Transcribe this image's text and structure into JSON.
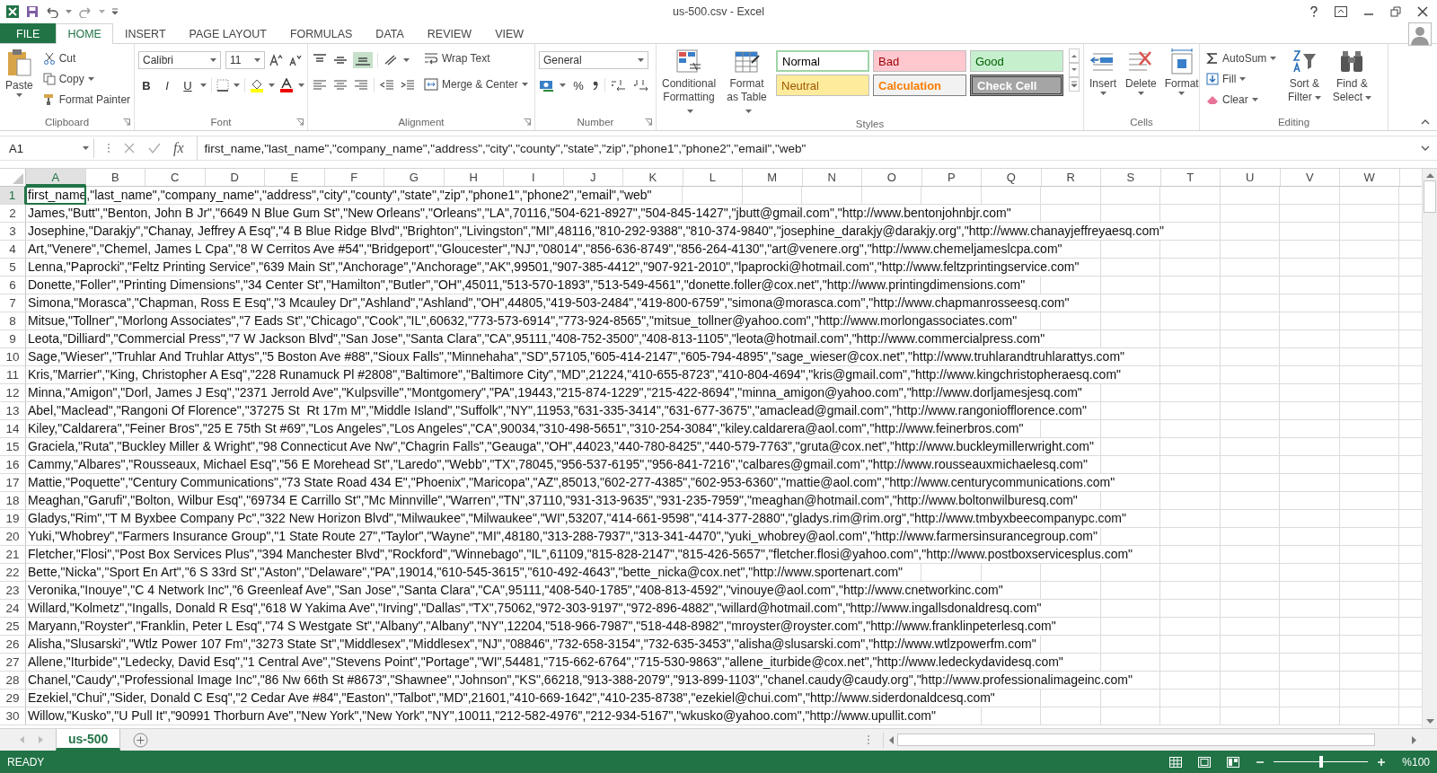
{
  "title_bar": {
    "title": "us-500.csv - Excel"
  },
  "tabs": [
    {
      "label": "FILE",
      "kind": "file",
      "selected": false
    },
    {
      "label": "HOME",
      "kind": "tab",
      "selected": true
    },
    {
      "label": "INSERT",
      "kind": "tab",
      "selected": false
    },
    {
      "label": "PAGE LAYOUT",
      "kind": "tab",
      "selected": false
    },
    {
      "label": "FORMULAS",
      "kind": "tab",
      "selected": false
    },
    {
      "label": "DATA",
      "kind": "tab",
      "selected": false
    },
    {
      "label": "REVIEW",
      "kind": "tab",
      "selected": false
    },
    {
      "label": "VIEW",
      "kind": "tab",
      "selected": false
    }
  ],
  "ribbon": {
    "clipboard": {
      "label": "Clipboard",
      "paste": "Paste",
      "cut": "Cut",
      "copy": "Copy",
      "format_painter": "Format Painter"
    },
    "font": {
      "label": "Font",
      "name": "Calibri",
      "size": "11",
      "bold": "B",
      "italic": "I",
      "underline": "U"
    },
    "alignment": {
      "label": "Alignment",
      "wrap_text": "Wrap Text",
      "merge_center": "Merge & Center"
    },
    "number": {
      "label": "Number",
      "format": "General",
      "percent": "%"
    },
    "styles": {
      "label": "Styles",
      "conditional_formatting": "Conditional Formatting",
      "format_as_table": "Format as Table",
      "cell_styles": [
        {
          "label": "Normal",
          "kind": "normal",
          "selected": true
        },
        {
          "label": "Bad",
          "kind": "bad",
          "selected": false
        },
        {
          "label": "Good",
          "kind": "good",
          "selected": false
        },
        {
          "label": "Neutral",
          "kind": "neutral",
          "selected": false
        },
        {
          "label": "Calculation",
          "kind": "calculation",
          "selected": false
        },
        {
          "label": "Check Cell",
          "kind": "check",
          "selected": false
        }
      ]
    },
    "cells": {
      "label": "Cells",
      "buttons": [
        "Insert",
        "Delete",
        "Format"
      ]
    },
    "editing": {
      "label": "Editing",
      "autosum": "AutoSum",
      "fill": "Fill",
      "clear": "Clear",
      "sort_filter": "Sort & Filter",
      "find_select": "Find & Select"
    }
  },
  "formula_bar": {
    "name_box": "A1",
    "fx": "fx",
    "formula": "first_name,\"last_name\",\"company_name\",\"address\",\"city\",\"county\",\"state\",\"zip\",\"phone1\",\"phone2\",\"email\",\"web\""
  },
  "columns": [
    {
      "label": "A",
      "selected": true
    },
    {
      "label": "B",
      "selected": false
    },
    {
      "label": "C",
      "selected": false
    },
    {
      "label": "D",
      "selected": false
    },
    {
      "label": "E",
      "selected": false
    },
    {
      "label": "F",
      "selected": false
    },
    {
      "label": "G",
      "selected": false
    },
    {
      "label": "H",
      "selected": false
    },
    {
      "label": "I",
      "selected": false
    },
    {
      "label": "J",
      "selected": false
    },
    {
      "label": "K",
      "selected": false
    },
    {
      "label": "L",
      "selected": false
    },
    {
      "label": "M",
      "selected": false
    },
    {
      "label": "N",
      "selected": false
    },
    {
      "label": "O",
      "selected": false
    },
    {
      "label": "P",
      "selected": false
    },
    {
      "label": "Q",
      "selected": false
    },
    {
      "label": "R",
      "selected": false
    },
    {
      "label": "S",
      "selected": false
    },
    {
      "label": "T",
      "selected": false
    },
    {
      "label": "U",
      "selected": false
    },
    {
      "label": "V",
      "selected": false
    },
    {
      "label": "W",
      "selected": false
    }
  ],
  "rows": [
    {
      "number": "1",
      "selected": true,
      "text": "first_name,\"last_name\",\"company_name\",\"address\",\"city\",\"county\",\"state\",\"zip\",\"phone1\",\"phone2\",\"email\",\"web\""
    },
    {
      "number": "2",
      "selected": false,
      "text": "James,\"Butt\",\"Benton, John B Jr\",\"6649 N Blue Gum St\",\"New Orleans\",\"Orleans\",\"LA\",70116,\"504-621-8927\",\"504-845-1427\",\"jbutt@gmail.com\",\"http://www.bentonjohnbjr.com\""
    },
    {
      "number": "3",
      "selected": false,
      "text": "Josephine,\"Darakjy\",\"Chanay, Jeffrey A Esq\",\"4 B Blue Ridge Blvd\",\"Brighton\",\"Livingston\",\"MI\",48116,\"810-292-9388\",\"810-374-9840\",\"josephine_darakjy@darakjy.org\",\"http://www.chanayjeffreyaesq.com\""
    },
    {
      "number": "4",
      "selected": false,
      "text": "Art,\"Venere\",\"Chemel, James L Cpa\",\"8 W Cerritos Ave #54\",\"Bridgeport\",\"Gloucester\",\"NJ\",\"08014\",\"856-636-8749\",\"856-264-4130\",\"art@venere.org\",\"http://www.chemeljameslcpa.com\""
    },
    {
      "number": "5",
      "selected": false,
      "text": "Lenna,\"Paprocki\",\"Feltz Printing Service\",\"639 Main St\",\"Anchorage\",\"Anchorage\",\"AK\",99501,\"907-385-4412\",\"907-921-2010\",\"lpaprocki@hotmail.com\",\"http://www.feltzprintingservice.com\""
    },
    {
      "number": "6",
      "selected": false,
      "text": "Donette,\"Foller\",\"Printing Dimensions\",\"34 Center St\",\"Hamilton\",\"Butler\",\"OH\",45011,\"513-570-1893\",\"513-549-4561\",\"donette.foller@cox.net\",\"http://www.printingdimensions.com\""
    },
    {
      "number": "7",
      "selected": false,
      "text": "Simona,\"Morasca\",\"Chapman, Ross E Esq\",\"3 Mcauley Dr\",\"Ashland\",\"Ashland\",\"OH\",44805,\"419-503-2484\",\"419-800-6759\",\"simona@morasca.com\",\"http://www.chapmanrosseesq.com\""
    },
    {
      "number": "8",
      "selected": false,
      "text": "Mitsue,\"Tollner\",\"Morlong Associates\",\"7 Eads St\",\"Chicago\",\"Cook\",\"IL\",60632,\"773-573-6914\",\"773-924-8565\",\"mitsue_tollner@yahoo.com\",\"http://www.morlongassociates.com\""
    },
    {
      "number": "9",
      "selected": false,
      "text": "Leota,\"Dilliard\",\"Commercial Press\",\"7 W Jackson Blvd\",\"San Jose\",\"Santa Clara\",\"CA\",95111,\"408-752-3500\",\"408-813-1105\",\"leota@hotmail.com\",\"http://www.commercialpress.com\""
    },
    {
      "number": "10",
      "selected": false,
      "text": "Sage,\"Wieser\",\"Truhlar And Truhlar Attys\",\"5 Boston Ave #88\",\"Sioux Falls\",\"Minnehaha\",\"SD\",57105,\"605-414-2147\",\"605-794-4895\",\"sage_wieser@cox.net\",\"http://www.truhlarandtruhlarattys.com\""
    },
    {
      "number": "11",
      "selected": false,
      "text": "Kris,\"Marrier\",\"King, Christopher A Esq\",\"228 Runamuck Pl #2808\",\"Baltimore\",\"Baltimore City\",\"MD\",21224,\"410-655-8723\",\"410-804-4694\",\"kris@gmail.com\",\"http://www.kingchristopheraesq.com\""
    },
    {
      "number": "12",
      "selected": false,
      "text": "Minna,\"Amigon\",\"Dorl, James J Esq\",\"2371 Jerrold Ave\",\"Kulpsville\",\"Montgomery\",\"PA\",19443,\"215-874-1229\",\"215-422-8694\",\"minna_amigon@yahoo.com\",\"http://www.dorljamesjesq.com\""
    },
    {
      "number": "13",
      "selected": false,
      "text": "Abel,\"Maclead\",\"Rangoni Of Florence\",\"37275 St  Rt 17m M\",\"Middle Island\",\"Suffolk\",\"NY\",11953,\"631-335-3414\",\"631-677-3675\",\"amaclead@gmail.com\",\"http://www.rangoniofflorence.com\""
    },
    {
      "number": "14",
      "selected": false,
      "text": "Kiley,\"Caldarera\",\"Feiner Bros\",\"25 E 75th St #69\",\"Los Angeles\",\"Los Angeles\",\"CA\",90034,\"310-498-5651\",\"310-254-3084\",\"kiley.caldarera@aol.com\",\"http://www.feinerbros.com\""
    },
    {
      "number": "15",
      "selected": false,
      "text": "Graciela,\"Ruta\",\"Buckley Miller & Wright\",\"98 Connecticut Ave Nw\",\"Chagrin Falls\",\"Geauga\",\"OH\",44023,\"440-780-8425\",\"440-579-7763\",\"gruta@cox.net\",\"http://www.buckleymillerwright.com\""
    },
    {
      "number": "16",
      "selected": false,
      "text": "Cammy,\"Albares\",\"Rousseaux, Michael Esq\",\"56 E Morehead St\",\"Laredo\",\"Webb\",\"TX\",78045,\"956-537-6195\",\"956-841-7216\",\"calbares@gmail.com\",\"http://www.rousseauxmichaelesq.com\""
    },
    {
      "number": "17",
      "selected": false,
      "text": "Mattie,\"Poquette\",\"Century Communications\",\"73 State Road 434 E\",\"Phoenix\",\"Maricopa\",\"AZ\",85013,\"602-277-4385\",\"602-953-6360\",\"mattie@aol.com\",\"http://www.centurycommunications.com\""
    },
    {
      "number": "18",
      "selected": false,
      "text": "Meaghan,\"Garufi\",\"Bolton, Wilbur Esq\",\"69734 E Carrillo St\",\"Mc Minnville\",\"Warren\",\"TN\",37110,\"931-313-9635\",\"931-235-7959\",\"meaghan@hotmail.com\",\"http://www.boltonwilburesq.com\""
    },
    {
      "number": "19",
      "selected": false,
      "text": "Gladys,\"Rim\",\"T M Byxbee Company Pc\",\"322 New Horizon Blvd\",\"Milwaukee\",\"Milwaukee\",\"WI\",53207,\"414-661-9598\",\"414-377-2880\",\"gladys.rim@rim.org\",\"http://www.tmbyxbeecompanypc.com\""
    },
    {
      "number": "20",
      "selected": false,
      "text": "Yuki,\"Whobrey\",\"Farmers Insurance Group\",\"1 State Route 27\",\"Taylor\",\"Wayne\",\"MI\",48180,\"313-288-7937\",\"313-341-4470\",\"yuki_whobrey@aol.com\",\"http://www.farmersinsurancegroup.com\""
    },
    {
      "number": "21",
      "selected": false,
      "text": "Fletcher,\"Flosi\",\"Post Box Services Plus\",\"394 Manchester Blvd\",\"Rockford\",\"Winnebago\",\"IL\",61109,\"815-828-2147\",\"815-426-5657\",\"fletcher.flosi@yahoo.com\",\"http://www.postboxservicesplus.com\""
    },
    {
      "number": "22",
      "selected": false,
      "text": "Bette,\"Nicka\",\"Sport En Art\",\"6 S 33rd St\",\"Aston\",\"Delaware\",\"PA\",19014,\"610-545-3615\",\"610-492-4643\",\"bette_nicka@cox.net\",\"http://www.sportenart.com\""
    },
    {
      "number": "23",
      "selected": false,
      "text": "Veronika,\"Inouye\",\"C 4 Network Inc\",\"6 Greenleaf Ave\",\"San Jose\",\"Santa Clara\",\"CA\",95111,\"408-540-1785\",\"408-813-4592\",\"vinouye@aol.com\",\"http://www.cnetworkinc.com\""
    },
    {
      "number": "24",
      "selected": false,
      "text": "Willard,\"Kolmetz\",\"Ingalls, Donald R Esq\",\"618 W Yakima Ave\",\"Irving\",\"Dallas\",\"TX\",75062,\"972-303-9197\",\"972-896-4882\",\"willard@hotmail.com\",\"http://www.ingallsdonaldresq.com\""
    },
    {
      "number": "25",
      "selected": false,
      "text": "Maryann,\"Royster\",\"Franklin, Peter L Esq\",\"74 S Westgate St\",\"Albany\",\"Albany\",\"NY\",12204,\"518-966-7987\",\"518-448-8982\",\"mroyster@royster.com\",\"http://www.franklinpeterlesq.com\""
    },
    {
      "number": "26",
      "selected": false,
      "text": "Alisha,\"Slusarski\",\"Wtlz Power 107 Fm\",\"3273 State St\",\"Middlesex\",\"Middlesex\",\"NJ\",\"08846\",\"732-658-3154\",\"732-635-3453\",\"alisha@slusarski.com\",\"http://www.wtlzpowerfm.com\""
    },
    {
      "number": "27",
      "selected": false,
      "text": "Allene,\"Iturbide\",\"Ledecky, David Esq\",\"1 Central Ave\",\"Stevens Point\",\"Portage\",\"WI\",54481,\"715-662-6764\",\"715-530-9863\",\"allene_iturbide@cox.net\",\"http://www.ledeckydavidesq.com\""
    },
    {
      "number": "28",
      "selected": false,
      "text": "Chanel,\"Caudy\",\"Professional Image Inc\",\"86 Nw 66th St #8673\",\"Shawnee\",\"Johnson\",\"KS\",66218,\"913-388-2079\",\"913-899-1103\",\"chanel.caudy@caudy.org\",\"http://www.professionalimageinc.com\""
    },
    {
      "number": "29",
      "selected": false,
      "text": "Ezekiel,\"Chui\",\"Sider, Donald C Esq\",\"2 Cedar Ave #84\",\"Easton\",\"Talbot\",\"MD\",21601,\"410-669-1642\",\"410-235-8738\",\"ezekiel@chui.com\",\"http://www.siderdonaldcesq.com\""
    },
    {
      "number": "30",
      "selected": false,
      "text": "Willow,\"Kusko\",\"U Pull It\",\"90991 Thorburn Ave\",\"New York\",\"New York\",\"NY\",10011,\"212-582-4976\",\"212-934-5167\",\"wkusko@yahoo.com\",\"http://www.upullit.com\""
    }
  ],
  "sheet_tabs": [
    {
      "label": "us-500",
      "selected": true
    }
  ],
  "status_bar": {
    "status": "READY",
    "zoom_slider": {
      "level": 0.5
    },
    "zoom": "%100"
  }
}
